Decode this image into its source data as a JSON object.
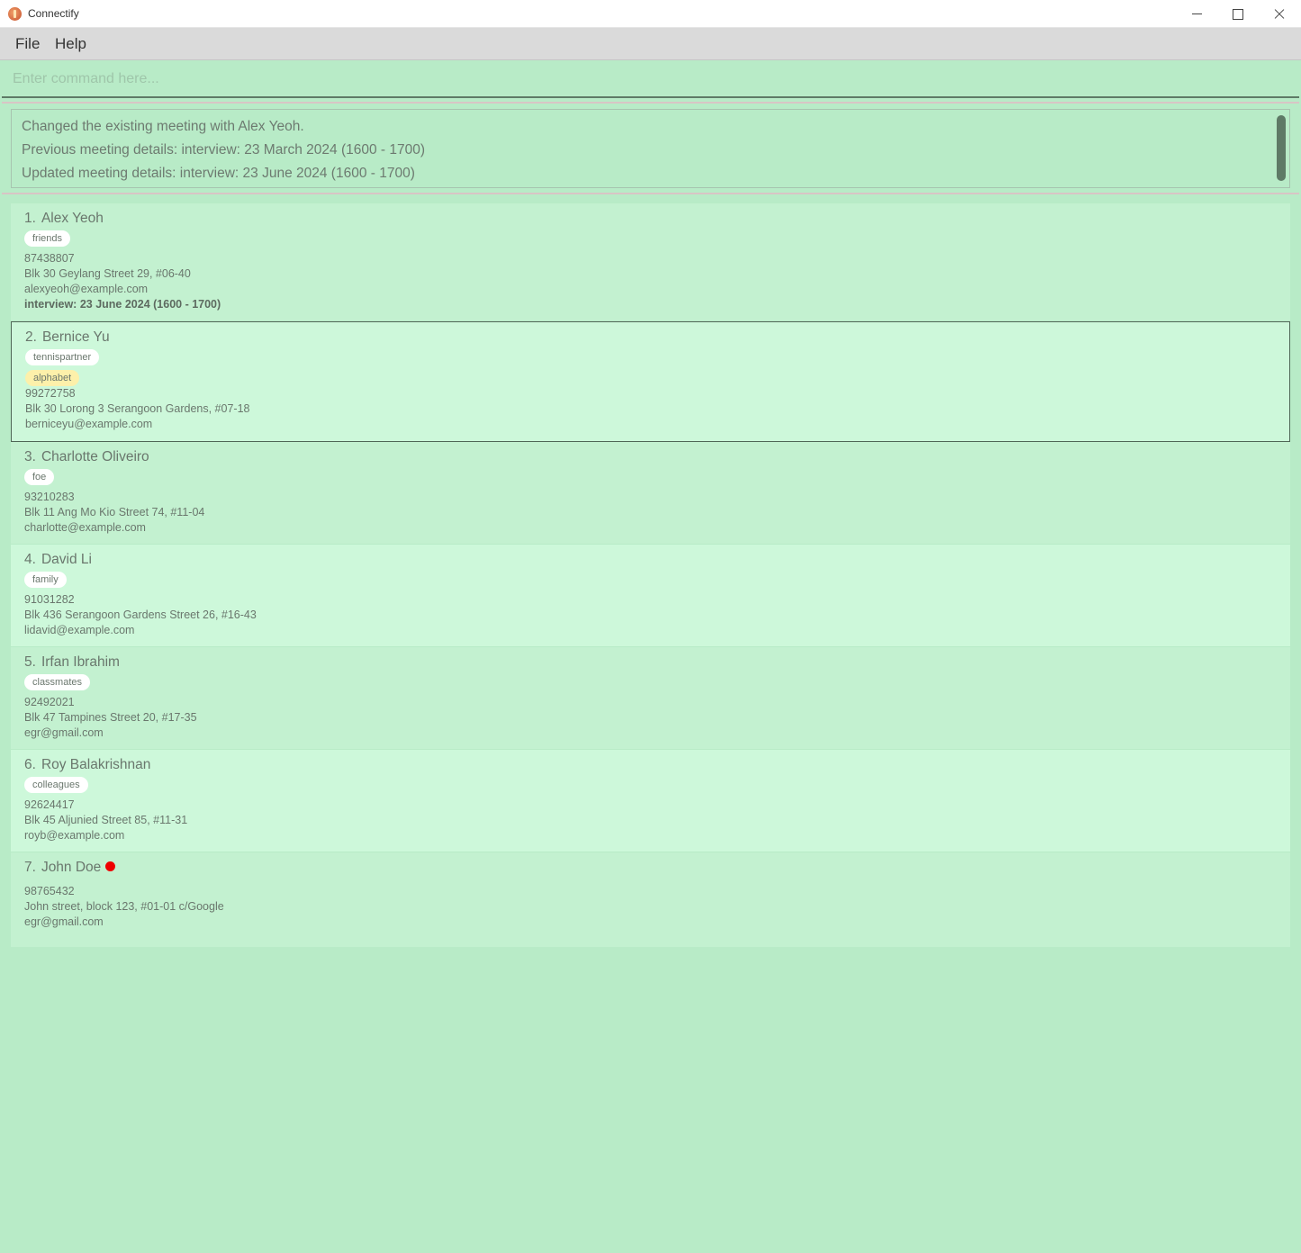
{
  "window": {
    "title": "Connectify"
  },
  "menu": {
    "file": "File",
    "help": "Help"
  },
  "command": {
    "placeholder": "Enter command here...",
    "value": ""
  },
  "result": {
    "lines": [
      "Changed the existing meeting with Alex Yeoh.",
      "Previous meeting details: interview: 23 March 2024 (1600 - 1700)",
      "Updated meeting details: interview: 23 June 2024 (1600 - 1700)"
    ]
  },
  "persons": [
    {
      "index": "1.",
      "name": "Alex Yeoh",
      "tags": [
        "friends"
      ],
      "phone": "87438807",
      "address": "Blk 30 Geylang Street 29, #06-40",
      "email": "alexyeoh@example.com",
      "meeting": "interview: 23 June 2024 (1600 - 1700)"
    },
    {
      "index": "2.",
      "name": "Bernice Yu",
      "tags": [
        "tennispartner",
        "alphabet"
      ],
      "phone": "99272758",
      "address": "Blk 30 Lorong 3 Serangoon Gardens, #07-18",
      "email": "berniceyu@example.com"
    },
    {
      "index": "3.",
      "name": "Charlotte Oliveiro",
      "tags": [
        "foe"
      ],
      "phone": "93210283",
      "address": "Blk 11 Ang Mo Kio Street 74, #11-04",
      "email": "charlotte@example.com"
    },
    {
      "index": "4.",
      "name": "David Li",
      "tags": [
        "family"
      ],
      "phone": "91031282",
      "address": "Blk 436 Serangoon Gardens Street 26, #16-43",
      "email": "lidavid@example.com"
    },
    {
      "index": "5.",
      "name": "Irfan Ibrahim",
      "tags": [
        "classmates"
      ],
      "phone": "92492021",
      "address": "Blk 47 Tampines Street 20, #17-35",
      "email": "egr@gmail.com"
    },
    {
      "index": "6.",
      "name": "Roy Balakrishnan",
      "tags": [
        "colleagues"
      ],
      "phone": "92624417",
      "address": "Blk 45 Aljunied Street 85, #11-31",
      "email": "royb@example.com"
    },
    {
      "index": "7.",
      "name": "John Doe",
      "tags": [],
      "phone": "98765432",
      "address": "John street, block 123, #01-01 c/Google",
      "email": "egr@gmail.com",
      "status_dot_color": "#ee0000"
    }
  ],
  "colors": {
    "background": "#b8ebc7",
    "card_odd": "#c3f1d0",
    "card_even": "#cdf8da",
    "selected_border": "#4f6656",
    "alphabet_tag": "#fdf0aa"
  }
}
